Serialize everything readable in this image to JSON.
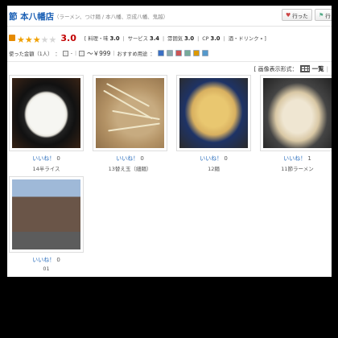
{
  "header": {
    "title": "節 本八幡店",
    "subtitle": "（ラーメン、つけ麺 / 本八幡、京成八幡、鬼越）",
    "button_went": "行った",
    "button_want": "行"
  },
  "rating": {
    "stars_filled": 3,
    "stars_total": 5,
    "score": "3.0",
    "bracket_open": "[",
    "bracket_close": "]",
    "taste_label": "料理・味",
    "taste_value": "3.0",
    "service_label": "サービス",
    "service_value": "3.4",
    "atmosphere_label": "雰囲気",
    "atmosphere_value": "3.0",
    "cp_label": "CP",
    "cp_value": "3.0",
    "drink_label": "酒・ドリンク",
    "drink_value": "-"
  },
  "info": {
    "spent_label": "使った金額（1人）",
    "colon": "：",
    "night_value": "-",
    "lunch_value": "～￥999",
    "purpose_label": "おすすめ用途",
    "purpose_icon_count": 6
  },
  "view": {
    "label": "[ 画像表示形式：",
    "mode": "一覧",
    "divider": "|"
  },
  "photos": [
    {
      "likes_label": "いいね！",
      "likes_count": "0",
      "caption": "14半ライス"
    },
    {
      "likes_label": "いいね！",
      "likes_count": "0",
      "caption": "13替え玉（細麺）"
    },
    {
      "likes_label": "いいね！",
      "likes_count": "0",
      "caption": "12麺"
    },
    {
      "likes_label": "いいね！",
      "likes_count": "1",
      "caption": "11節ラーメン"
    },
    {
      "likes_label": "いいね！",
      "likes_count": "0",
      "caption": "01"
    }
  ],
  "colors": {
    "title": "#1a5fb4",
    "score": "#c20000",
    "star_on": "#f0a000",
    "link": "#2a6ebd"
  },
  "icons": [
    "rank-badge-icon",
    "star-icon",
    "heart-icon",
    "flag-icon",
    "grid-view-icon",
    "night-icon",
    "lunch-icon"
  ]
}
